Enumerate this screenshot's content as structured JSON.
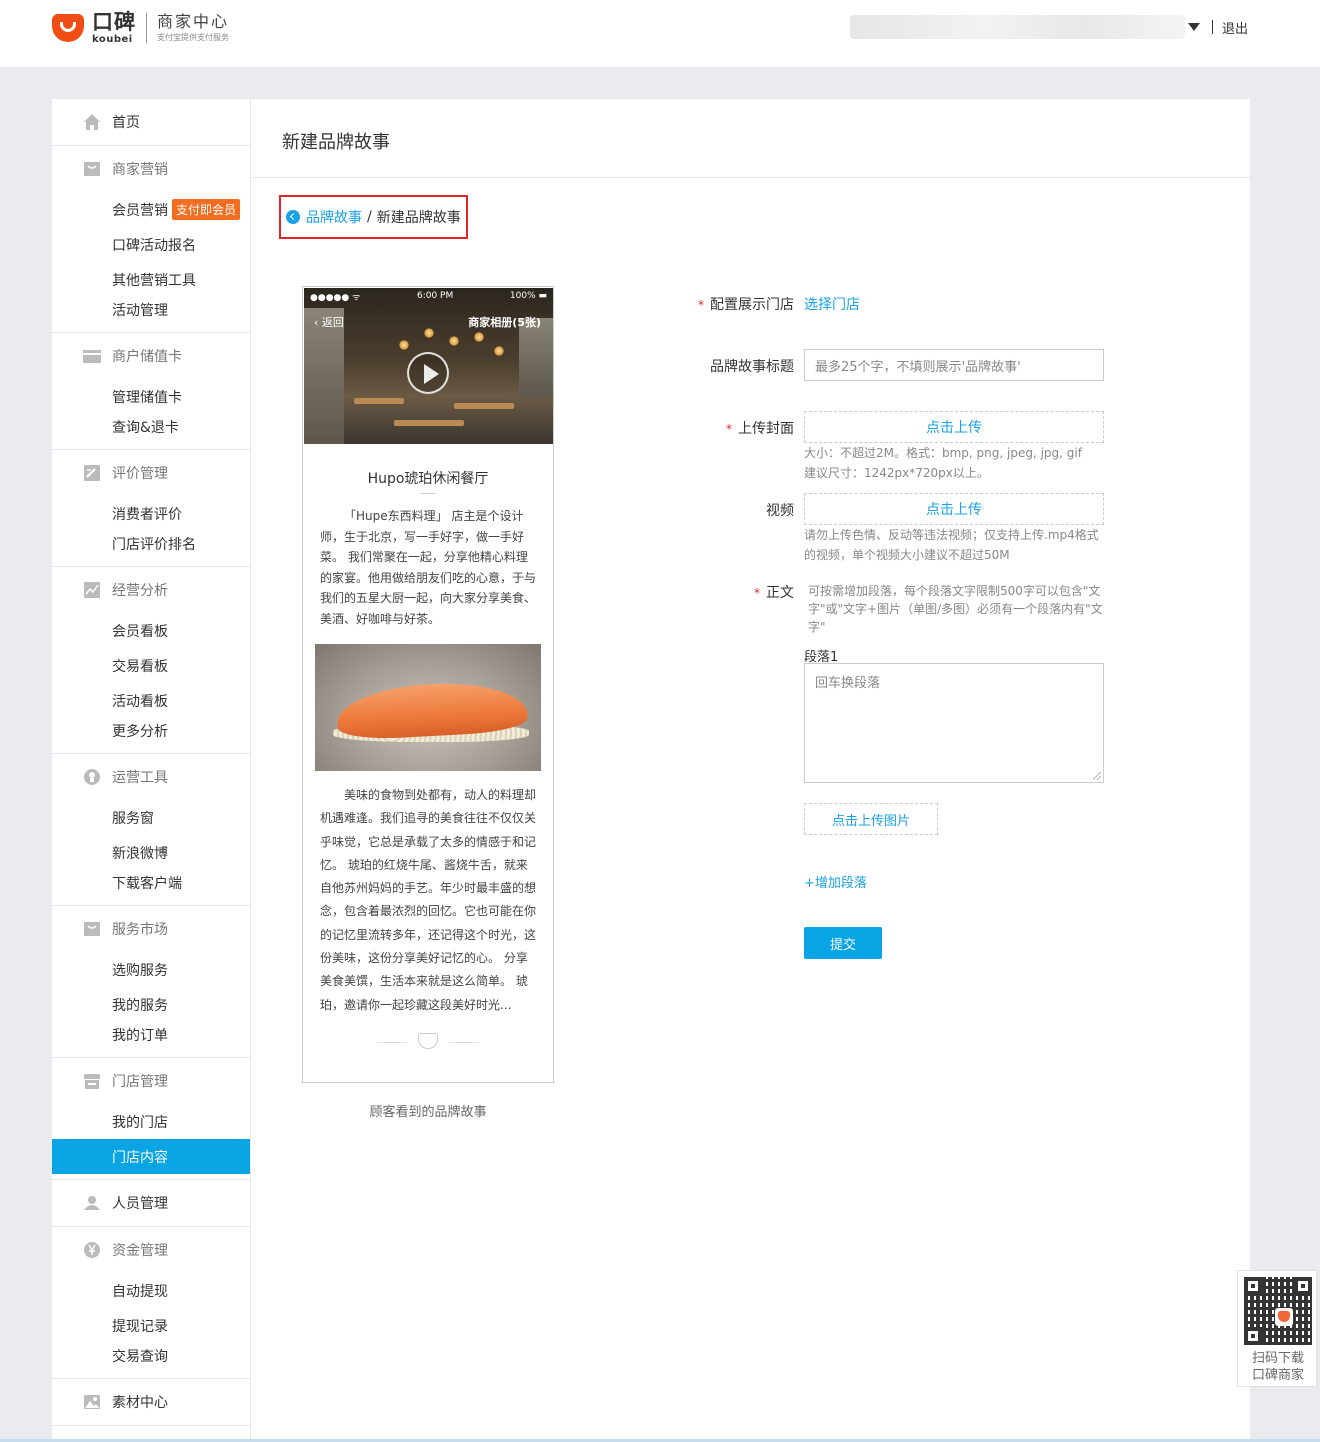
{
  "header": {
    "logo_cn": "口碑",
    "logo_en": "koubei",
    "center_title": "商家中心",
    "center_sub": "支付宝提供支付服务",
    "logout": "退出"
  },
  "sidebar": {
    "home": "首页",
    "groups": [
      {
        "title": "商家营销",
        "items": [
          "会员营销",
          "口碑活动报名",
          "其他营销工具",
          "活动管理"
        ],
        "badge": "支付即会员"
      },
      {
        "title": "商户储值卡",
        "items": [
          "管理储值卡",
          "查询&退卡"
        ]
      },
      {
        "title": "评价管理",
        "items": [
          "消费者评价",
          "门店评价排名"
        ]
      },
      {
        "title": "经营分析",
        "items": [
          "会员看板",
          "交易看板",
          "活动看板",
          "更多分析"
        ]
      },
      {
        "title": "运营工具",
        "items": [
          "服务窗",
          "新浪微博",
          "下载客户端"
        ]
      },
      {
        "title": "服务市场",
        "items": [
          "选购服务",
          "我的服务",
          "我的订单"
        ]
      },
      {
        "title": "门店管理",
        "items": [
          "我的门店",
          "门店内容"
        ]
      },
      {
        "title": "人员管理",
        "items": []
      },
      {
        "title": "资金管理",
        "items": [
          "自动提现",
          "提现记录",
          "交易查询"
        ]
      },
      {
        "title": "素材中心",
        "items": []
      }
    ]
  },
  "page": {
    "title": "新建品牌故事",
    "breadcrumb_link": "品牌故事",
    "breadcrumb_sep": "/",
    "breadcrumb_current": "新建品牌故事"
  },
  "preview": {
    "status_left": "●●●●● ᯤ",
    "status_time": "6:00 PM",
    "status_right": "100% ▬",
    "back": "返回",
    "album": "商家相册(5张)",
    "store_name": "Hupo琥珀休闲餐厅",
    "para1": "「Hupe东西料理」 店主是个设计师，生于北京，写一手好字，做一手好菜。 我们常聚在一起，分享他精心料理的家宴。他用做给朋友们吃的心意，于与我们的五星大厨一起，向大家分享美食、美酒、好咖啡与好茶。",
    "para2": "美味的食物到处都有，动人的料理却机遇难逢。我们追寻的美食往往不仅仅关乎味觉，它总是承载了太多的情感于和记忆。 琥珀的红烧牛尾、酱烧牛舌，就来自他苏州妈妈的手艺。年少时最丰盛的想念，包含着最浓烈的回忆。它也可能在你的记忆里流转多年，还记得这个时光，这份美味，这份分享美好记忆的心。 分享美食美馔，生活本来就是这么简单。 琥珀，邀请你一起珍藏这段美好时光...",
    "caption": "顾客看到的品牌故事"
  },
  "form": {
    "store_label": "配置展示门店",
    "store_link": "选择门店",
    "title_label": "品牌故事标题",
    "title_placeholder": "最多25个字，不填则展示'品牌故事'",
    "cover_label": "上传封面",
    "cover_upload": "点击上传",
    "cover_hint1": "大小：不超过2M。格式：bmp, png, jpeg, jpg, gif",
    "cover_hint2": "建议尺寸：1242px*720px以上。",
    "video_label": "视频",
    "video_upload": "点击上传",
    "video_hint": "请勿上传色情、反动等违法视频；仅支持上传.mp4格式的视频，单个视频大小建议不超过50M",
    "body_label": "正文",
    "body_hint": "可按需增加段落，每个段落文字限制500字可以包含\"文字\"或\"文字+图片（单图/多图）必须有一个段落内有\"文字\"",
    "para_label": "段落1",
    "para_placeholder": "回车换段落",
    "upload_image": "点击上传图片",
    "add_para": "+增加段落",
    "submit": "提交",
    "required_mark": "*"
  },
  "qr": {
    "line1": "扫码下载",
    "line2": "口碑商家"
  },
  "colors": {
    "brand_orange": "#f04e14",
    "link_blue": "#1aa3e4",
    "active_blue": "#09a4e3",
    "highlight_red": "#e0262b"
  }
}
